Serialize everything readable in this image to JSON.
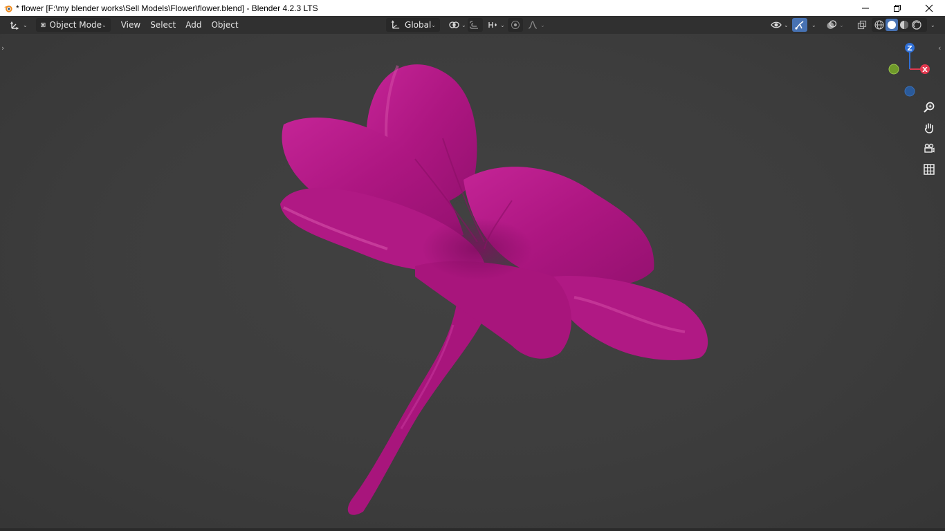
{
  "window": {
    "title": "* flower [F:\\my blender works\\Sell Models\\Flower\\flower.blend] - Blender 4.2.3 LTS",
    "controls": [
      "minimize-icon",
      "restore-icon",
      "close-icon"
    ]
  },
  "header": {
    "editor_type_icon": "transform-gizmo-icon",
    "mode": {
      "icon": "object-mode-icon",
      "label": "Object Mode"
    },
    "menus": [
      "View",
      "Select",
      "Add",
      "Object"
    ],
    "transform_orientation": {
      "icon": "orientation-icon",
      "label": "Global"
    },
    "pivot_icon": "pivot-point-icon",
    "snap_icon": "magnet-icon",
    "snap_target_icon": "snap-increment-icon",
    "proportional_icon": "proportional-edit-icon",
    "falloff_icon": "falloff-curve-icon",
    "right_tools": [
      "visibility-icon",
      "gizmo-toggle-icon",
      "overlay-icon",
      "xray-icon"
    ],
    "shading_modes": [
      "wireframe-shading-icon",
      "solid-shading-icon",
      "material-shading-icon",
      "rendered-shading-icon"
    ],
    "active_shading": "solid-shading-icon",
    "accent": "#4772b3"
  },
  "viewport": {
    "object_color": "#b0187f",
    "background": "#3d3d3d",
    "gizmo": {
      "z_label": "Z",
      "x_label": "X",
      "z_color": "#2f6fd6",
      "x_color": "#e2394f",
      "y_color": "#7aa832"
    },
    "nav_tools": [
      "zoom-icon",
      "pan-hand-icon",
      "camera-view-icon",
      "ortho-grid-icon"
    ]
  }
}
